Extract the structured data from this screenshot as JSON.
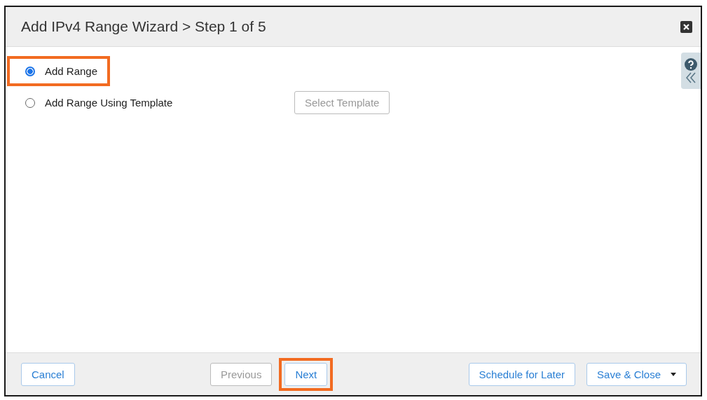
{
  "window": {
    "title": "Add IPv4 Range Wizard > Step 1 of 5"
  },
  "options": [
    {
      "label": "Add Range",
      "selected": true,
      "highlighted": true
    },
    {
      "label": "Add Range Using Template",
      "selected": false,
      "highlighted": false
    }
  ],
  "template_button": {
    "label": "Select Template",
    "disabled": true
  },
  "footer": {
    "buttons": [
      {
        "kind": "plain",
        "label": "Cancel",
        "disabled": false,
        "highlighted": false
      },
      {
        "kind": "plain",
        "label": "Previous",
        "disabled": true,
        "highlighted": false
      },
      {
        "kind": "plain",
        "label": "Next",
        "disabled": false,
        "highlighted": true
      },
      {
        "kind": "plain",
        "label": "Schedule for Later",
        "disabled": false,
        "highlighted": false
      },
      {
        "kind": "split",
        "label": "Save & Close",
        "disabled": false,
        "highlighted": false
      }
    ]
  }
}
